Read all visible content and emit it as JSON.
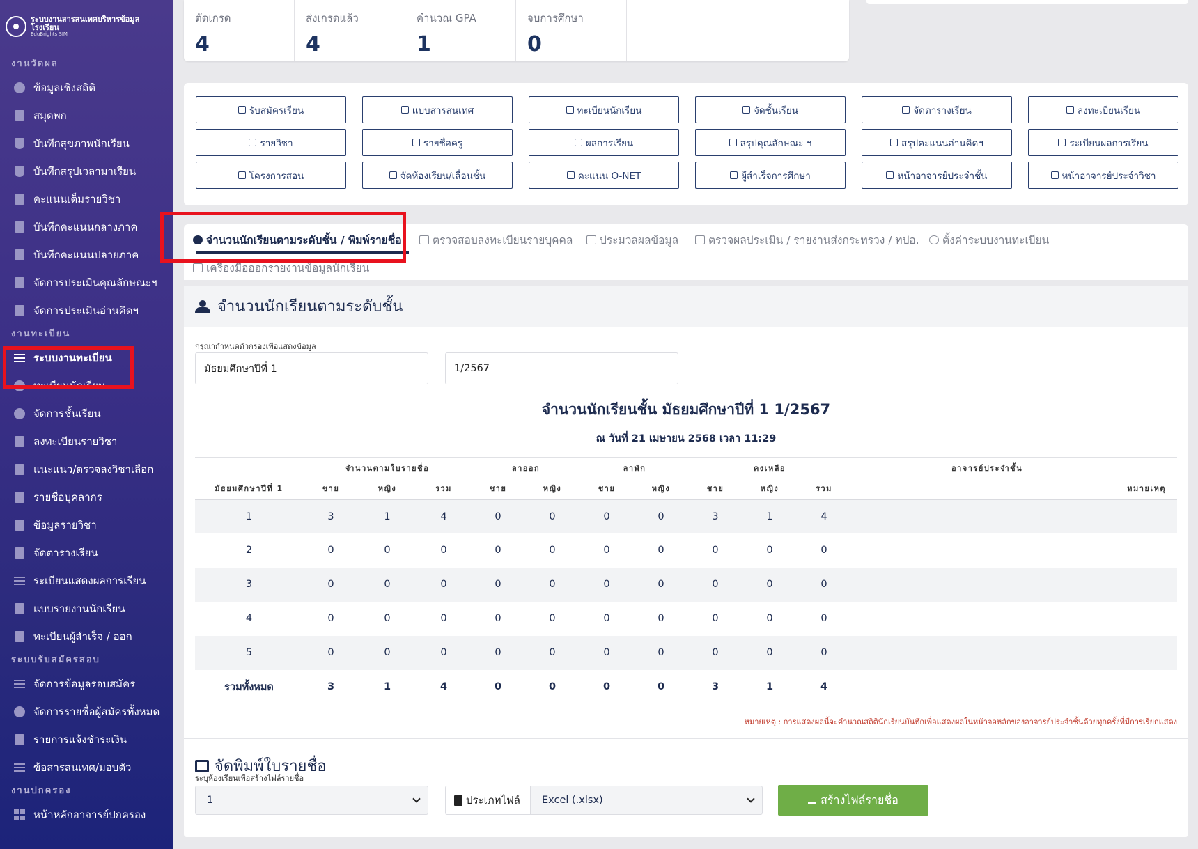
{
  "brand": {
    "title": "ระบบงานสารสนเทศบริหารข้อมูลโรงเรียน",
    "subtitle": "EduBrights SIM"
  },
  "sidebar": {
    "sections": [
      {
        "label": "งานวัดผล",
        "items": [
          {
            "label": "ข้อมูลเชิงสถิติ",
            "icon": "pie-chart-icon"
          },
          {
            "label": "สมุดพก",
            "icon": "book-icon"
          },
          {
            "label": "บันทึกสุขภาพนักเรียน",
            "icon": "shield-icon"
          },
          {
            "label": "บันทึกสรุปเวลามาเรียน",
            "icon": "shield-icon"
          },
          {
            "label": "คะแนนเต็มรายวิชา",
            "icon": "book-icon"
          },
          {
            "label": "บันทึกคะแนนกลางภาค",
            "icon": "book-icon"
          },
          {
            "label": "บันทึกคะแนนปลายภาค",
            "icon": "book-icon"
          },
          {
            "label": "จัดการประเมินคุณลักษณะฯ",
            "icon": "book-icon"
          },
          {
            "label": "จัดการประเมินอ่านคิดฯ",
            "icon": "book-icon"
          }
        ]
      },
      {
        "label": "งานทะเบียน",
        "items": [
          {
            "label": "ระบบงานทะเบียน",
            "icon": "list-icon",
            "active": true
          },
          {
            "label": "ทะเบียนนักเรียน",
            "icon": "face-icon"
          },
          {
            "label": "จัดการชั้นเรียน",
            "icon": "user-circle-icon"
          },
          {
            "label": "ลงทะเบียนรายวิชา",
            "icon": "register-icon"
          },
          {
            "label": "แนะแนว/ตรวจลงวิชาเลือก",
            "icon": "plus-square-icon"
          },
          {
            "label": "รายชื่อบุคลากร",
            "icon": "id-badge-icon"
          },
          {
            "label": "ข้อมูลรายวิชา",
            "icon": "open-book-icon"
          },
          {
            "label": "จัดตารางเรียน",
            "icon": "calendar-icon"
          },
          {
            "label": "ระเบียนแสดงผลการเรียน",
            "icon": "list-icon"
          },
          {
            "label": "แบบรายงานนักเรียน",
            "icon": "printer-icon"
          },
          {
            "label": "ทะเบียนผู้สำเร็จ / ออก",
            "icon": "graduation-cap-icon"
          }
        ]
      },
      {
        "label": "ระบบรับสมัครสอบ",
        "items": [
          {
            "label": "จัดการข้อมูลรอบสมัคร",
            "icon": "list-icon"
          },
          {
            "label": "จัดการรายชื่อผู้สมัครทั้งหมด",
            "icon": "user-icon"
          },
          {
            "label": "รายการแจ้งชำระเงิน",
            "icon": "money-icon"
          },
          {
            "label": "ข้อสารสนเทศ/มอบตัว",
            "icon": "list-icon"
          }
        ]
      },
      {
        "label": "งานปกครอง",
        "items": [
          {
            "label": "หน้าหลักอาจารย์ปกครอง",
            "icon": "dashboard-icon"
          }
        ]
      }
    ]
  },
  "stats": [
    {
      "label": "ตัดเกรด",
      "value": "4"
    },
    {
      "label": "ส่งเกรดแล้ว",
      "value": "4"
    },
    {
      "label": "คำนวณ GPA",
      "value": "1"
    },
    {
      "label": "จบการศึกษา",
      "value": "0"
    }
  ],
  "quick_buttons": [
    "รับสมัครเรียน",
    "แบบสารสนเทศ",
    "ทะเบียนนักเรียน",
    "จัดชั้นเรียน",
    "จัดตารางเรียน",
    "ลงทะเบียนเรียน",
    "รายวิชา",
    "รายชื่อครู",
    "ผลการเรียน",
    "สรุปคุณลักษณะ ฯ",
    "สรุปคะแนนอ่านคิดฯ",
    "ระเบียนผลการเรียน",
    "โครงการสอน",
    "จัดห้องเรียน/เลื่อนชั้น",
    "คะแนน O-NET",
    "ผู้สำเร็จการศึกษา",
    "หน้าอาจารย์ประจำชั้น",
    "หน้าอาจารย์ประจำวิชา"
  ],
  "tabs": [
    "จำนวนนักเรียนตามระดับชั้น / พิมพ์รายชื่อ",
    "ตรวจสอบลงทะเบียนรายบุคคล",
    "ประมวลผลข้อมูล",
    "ตรวจผลประเมิน / รายงานส่งกระทรวง / ทปอ.",
    "ตั้งค่าระบบงานทะเบียน",
    "เครื่องมือออกรายงานข้อมูลนักเรียน"
  ],
  "section": {
    "title": "จำนวนนักเรียนตามระดับชั้น",
    "filter_label": "กรุณากำหนดตัวกรองเพื่อแสดงข้อมูล",
    "filter_level": "มัธยมศึกษาปีที่ 1",
    "filter_term": "1/2567",
    "table_title": "จำนวนนักเรียนชั้น มัธยมศึกษาปีที่ 1 1/2567",
    "table_subtitle": "ณ วันที่ 21 เมษายน 2568 เวลา 11:29",
    "note": "หมายเหตุ : การแสดงผลนี้จะคำนวณสถิตินักเรียนบันทึกเพื่อแสดงผลในหน้าจอหลักของอาจารย์ประจำชั้นด้วยทุกครั้งที่มีการเรียกแสดง"
  },
  "table": {
    "group_headers": [
      "จำนวนตามใบรายชื่อ",
      "ลาออก",
      "ลาพัก",
      "คงเหลือ",
      "อาจารย์ประจำชั้น"
    ],
    "columns": [
      "มัธยมศึกษาปีที่ 1",
      "ชาย",
      "หญิง",
      "รวม",
      "ชาย",
      "หญิง",
      "ชาย",
      "หญิง",
      "ชาย",
      "หญิง",
      "รวม",
      "หมายเหตุ"
    ],
    "rows": [
      [
        "1",
        "3",
        "1",
        "4",
        "0",
        "0",
        "0",
        "0",
        "3",
        "1",
        "4",
        ""
      ],
      [
        "2",
        "0",
        "0",
        "0",
        "0",
        "0",
        "0",
        "0",
        "0",
        "0",
        "0",
        ""
      ],
      [
        "3",
        "0",
        "0",
        "0",
        "0",
        "0",
        "0",
        "0",
        "0",
        "0",
        "0",
        ""
      ],
      [
        "4",
        "0",
        "0",
        "0",
        "0",
        "0",
        "0",
        "0",
        "0",
        "0",
        "0",
        ""
      ],
      [
        "5",
        "0",
        "0",
        "0",
        "0",
        "0",
        "0",
        "0",
        "0",
        "0",
        "0",
        ""
      ]
    ],
    "total": [
      "รวมทั้งหมด",
      "3",
      "1",
      "4",
      "0",
      "0",
      "0",
      "0",
      "3",
      "1",
      "4",
      ""
    ]
  },
  "print": {
    "title": "จัดพิมพ์ใบรายชื่อ",
    "hint": "ระบุห้องเรียนเพื่อสร้างไฟล์รายชื่อ",
    "room_value": "1",
    "filetype_label": "ประเภทไฟล์",
    "filetype_value": "Excel (.xlsx)",
    "button": "สร้างไฟล์รายชื่อ"
  },
  "colors": {
    "highlight": "#e8121e",
    "accent_green": "#6fae47",
    "navy": "#1d2b4f"
  }
}
